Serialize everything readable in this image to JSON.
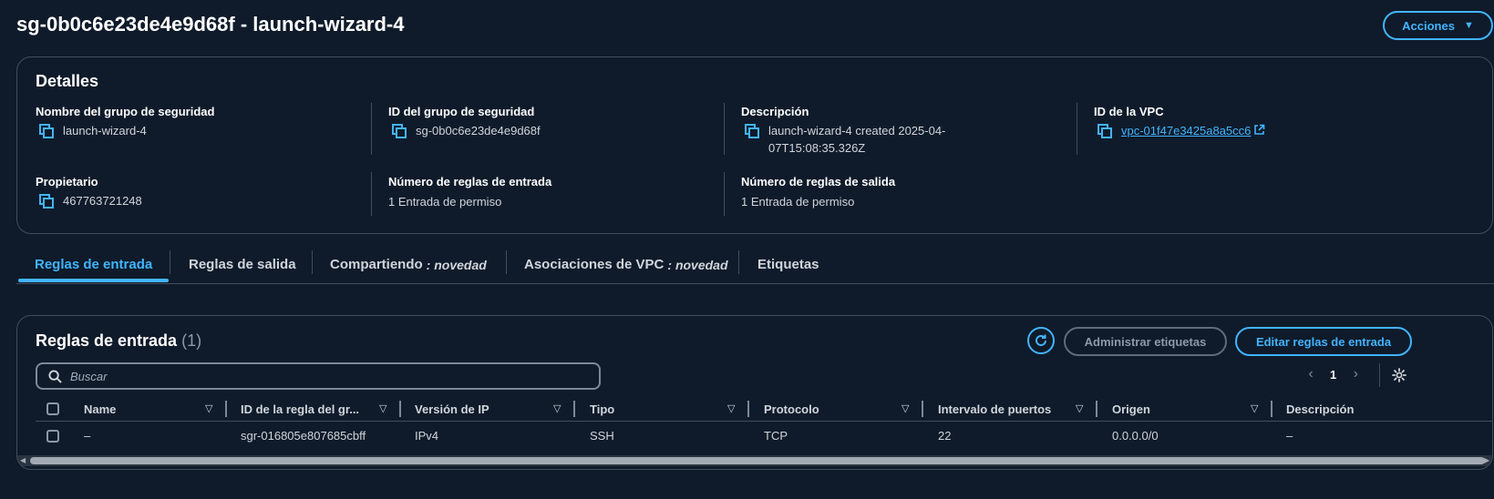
{
  "header": {
    "title": "sg-0b0c6e23de4e9d68f - launch-wizard-4",
    "actions_label": "Acciones"
  },
  "details": {
    "title": "Detalles",
    "fields": [
      {
        "label": "Nombre del grupo de seguridad",
        "value": "launch-wizard-4",
        "copy": true
      },
      {
        "label": "ID del grupo de seguridad",
        "value": "sg-0b0c6e23de4e9d68f",
        "copy": true
      },
      {
        "label": "Descripción",
        "value": "launch-wizard-4 created 2025-04-07T15:08:35.326Z",
        "copy": true
      },
      {
        "label": "ID de la VPC",
        "value": "vpc-01f47e3425a8a5cc6",
        "copy": true,
        "link": true
      },
      {
        "label": "Propietario",
        "value": "467763721248",
        "copy": true
      },
      {
        "label": "Número de reglas de entrada",
        "value": "1 Entrada de permiso",
        "copy": false
      },
      {
        "label": "Número de reglas de salida",
        "value": "1 Entrada de permiso",
        "copy": false
      }
    ]
  },
  "tabs": [
    {
      "label": "Reglas de entrada",
      "suffix": "",
      "active": true
    },
    {
      "label": "Reglas de salida",
      "suffix": "",
      "active": false
    },
    {
      "label": "Compartiendo",
      "suffix": ": novedad",
      "active": false
    },
    {
      "label": "Asociaciones de VPC",
      "suffix": ": novedad",
      "active": false
    },
    {
      "label": "Etiquetas",
      "suffix": "",
      "active": false
    }
  ],
  "rules": {
    "title": "Reglas de entrada",
    "count": "(1)",
    "manage_tags_label": "Administrar etiquetas",
    "edit_label": "Editar reglas de entrada",
    "search_placeholder": "Buscar",
    "page": "1",
    "columns": [
      "Name",
      "ID de la regla del gr...",
      "Versión de IP",
      "Tipo",
      "Protocolo",
      "Intervalo de puertos",
      "Origen",
      "Descripción"
    ],
    "rows": [
      [
        "–",
        "sgr-016805e807685cbff",
        "IPv4",
        "SSH",
        "TCP",
        "22",
        "0.0.0.0/0",
        "–"
      ]
    ]
  },
  "colors": {
    "background": "#0f1b2a",
    "accent": "#42b4ff",
    "border": "#414d5c"
  }
}
